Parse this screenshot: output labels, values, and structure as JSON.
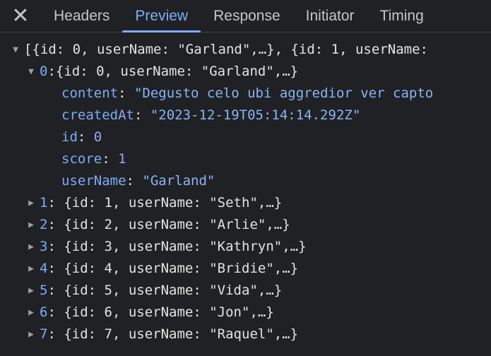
{
  "tabs": [
    {
      "label": "Headers",
      "active": false
    },
    {
      "label": "Preview",
      "active": true
    },
    {
      "label": "Response",
      "active": false
    },
    {
      "label": "Initiator",
      "active": false
    },
    {
      "label": "Timing",
      "active": false
    }
  ],
  "close_glyph": "✕",
  "root_summary": "[{id: 0, userName: \"Garland\",…}, {id: 1, userName:",
  "expanded": {
    "index": "0",
    "summary": "{id: 0, userName: \"Garland\",…}",
    "props": [
      {
        "key": "content",
        "value": "\"Degusto celo ubi aggredior ver capto",
        "type": "string"
      },
      {
        "key": "createdAt",
        "value": "\"2023-12-19T05:14:14.292Z\"",
        "type": "string"
      },
      {
        "key": "id",
        "value": "0",
        "type": "number"
      },
      {
        "key": "score",
        "value": "1",
        "type": "number"
      },
      {
        "key": "userName",
        "value": "\"Garland\"",
        "type": "string"
      }
    ]
  },
  "collapsed": [
    {
      "index": "1",
      "summary": "{id: 1, userName: \"Seth\",…}"
    },
    {
      "index": "2",
      "summary": "{id: 2, userName: \"Arlie\",…}"
    },
    {
      "index": "3",
      "summary": "{id: 3, userName: \"Kathryn\",…}"
    },
    {
      "index": "4",
      "summary": "{id: 4, userName: \"Bridie\",…}"
    },
    {
      "index": "5",
      "summary": "{id: 5, userName: \"Vida\",…}"
    },
    {
      "index": "6",
      "summary": "{id: 6, userName: \"Jon\",…}"
    },
    {
      "index": "7",
      "summary": "{id: 7, userName: \"Raquel\",…}"
    }
  ],
  "colors": {
    "background": "#202124",
    "accent": "#7cacf8",
    "string": "#8ab4f8",
    "number": "#a0a0ff"
  }
}
